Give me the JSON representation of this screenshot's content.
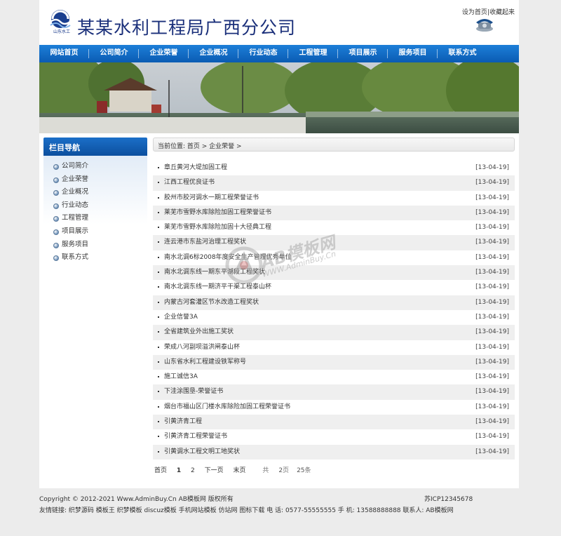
{
  "header": {
    "title": "某某水利工程局广西分公司",
    "logo_caption": "山东水工",
    "set_home": "设为首页",
    "separator": "|",
    "bookmark": "收藏起来"
  },
  "nav": [
    {
      "label": "网站首页"
    },
    {
      "label": "公司简介"
    },
    {
      "label": "企业荣誉"
    },
    {
      "label": "企业概况"
    },
    {
      "label": "行业动态"
    },
    {
      "label": "工程管理"
    },
    {
      "label": "项目展示"
    },
    {
      "label": "服务项目"
    },
    {
      "label": "联系方式"
    }
  ],
  "sidebar": {
    "title": "栏目导航",
    "items": [
      {
        "label": "公司简介"
      },
      {
        "label": "企业荣誉"
      },
      {
        "label": "企业概况"
      },
      {
        "label": "行业动态"
      },
      {
        "label": "工程管理"
      },
      {
        "label": "项目展示"
      },
      {
        "label": "服务项目"
      },
      {
        "label": "联系方式"
      }
    ]
  },
  "breadcrumb": "当前位置: 首页 > 企业荣誉 >",
  "articles": [
    {
      "title": "章丘黄河大堤加固工程",
      "date": "[13-04-19]"
    },
    {
      "title": "江西工程优良证书",
      "date": "[13-04-19]"
    },
    {
      "title": "胶州市胶河调水一期工程荣誉证书",
      "date": "[13-04-19]"
    },
    {
      "title": "莱芜市雪野水库除险加固工程荣誉证书",
      "date": "[13-04-19]"
    },
    {
      "title": "莱芜市雪野水库除险加固十大径典工程",
      "date": "[13-04-19]"
    },
    {
      "title": "连云港市东盐河治理工程奖状",
      "date": "[13-04-19]"
    },
    {
      "title": "南水北调6标2008年度安全生产管理优秀单位",
      "date": "[13-04-19]"
    },
    {
      "title": "南水北调东线一期东平湖段工程奖状",
      "date": "[13-04-19]"
    },
    {
      "title": "南水北调东线一期济平干渠工程泰山杯",
      "date": "[13-04-19]"
    },
    {
      "title": "内蒙古河套灌区节水改造工程奖状",
      "date": "[13-04-19]"
    },
    {
      "title": "企业信誉3A",
      "date": "[13-04-19]"
    },
    {
      "title": "全省建筑业外出施工奖状",
      "date": "[13-04-19]"
    },
    {
      "title": "荣成八河副坝溢洪闸泰山杯",
      "date": "[13-04-19]"
    },
    {
      "title": "山东省水利工程建设铁军称号",
      "date": "[13-04-19]"
    },
    {
      "title": "施工诚信3A",
      "date": "[13-04-19]"
    },
    {
      "title": "下洼涂围垦-荣誉证书",
      "date": "[13-04-19]"
    },
    {
      "title": "烟台市福山区门楼水库除险加固工程荣誉证书",
      "date": "[13-04-19]"
    },
    {
      "title": "引黄济青工程",
      "date": "[13-04-19]"
    },
    {
      "title": "引黄济青工程荣誉证书",
      "date": "[13-04-19]"
    },
    {
      "title": "引黄调水工程文明工地奖状",
      "date": "[13-04-19]"
    }
  ],
  "pager": {
    "first": "首页",
    "page1": "1",
    "page2": "2",
    "next": "下一页",
    "last": "末页",
    "total_prefix": "共",
    "total_pages": "2",
    "pages_word": "页",
    "total_items": "25",
    "items_word": "条"
  },
  "watermark": {
    "line1": "AB模板网",
    "line2": "WWW.AdminBuy.Cn"
  },
  "footer": {
    "copyright": "Copyright © 2012-2021 Www.AdminBuy.Cn AB模板网 版权所有",
    "icp": "苏ICP12345678",
    "links": "友情链接: 织梦源码 模板王 织梦模板 discuz模板 手机网站模板 仿站网 图标下载 电 话: 0577-55555555 手 机: 13588888888 联系人: AB模板网"
  }
}
